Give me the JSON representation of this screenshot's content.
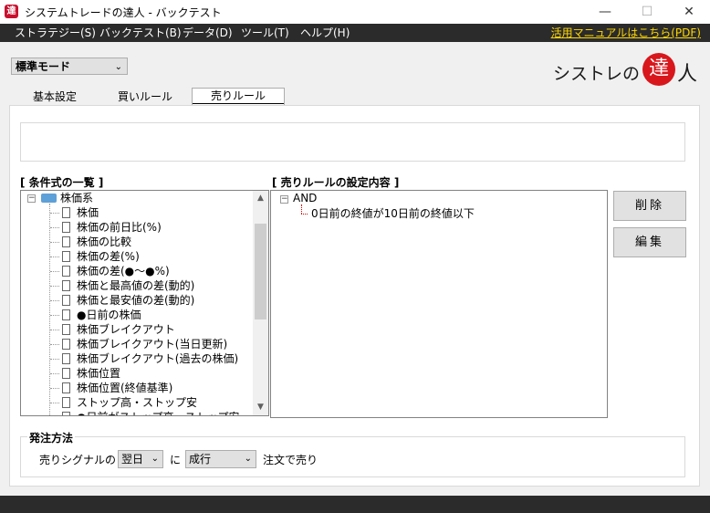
{
  "window": {
    "title": "システムトレードの達人 - バックテスト",
    "icon_glyph": "達",
    "minimize": "—",
    "maximize": "☐",
    "close": "✕"
  },
  "menu": {
    "items": [
      "ストラテジー(S)",
      "バックテスト(B)",
      "データ(D)",
      "ツール(T)",
      "ヘルプ(H)"
    ],
    "manual_link": "活用マニュアルはこちら(PDF)"
  },
  "mode": {
    "selected": "標準モード"
  },
  "logo": {
    "prefix": "シストレの",
    "seal": "達",
    "suffix": "人"
  },
  "tabs": [
    {
      "label": "基本設定",
      "active": false
    },
    {
      "label": "買いルール",
      "active": false
    },
    {
      "label": "売りルール",
      "active": true
    }
  ],
  "conditions": {
    "header": "[ 条件式の一覧 ]",
    "root": "株価系",
    "items": [
      "株価",
      "株価の前日比(%)",
      "株価の比較",
      "株価の差(%)",
      "株価の差(●〜●%)",
      "株価と最高値の差(動的)",
      "株価と最安値の差(動的)",
      "●日前の株価",
      "株価ブレイクアウト",
      "株価ブレイクアウト(当日更新)",
      "株価ブレイクアウト(過去の株価)",
      "株価位置",
      "株価位置(終値基準)",
      "ストップ高・ストップ安",
      "●日前がストップ高・ストップ安"
    ]
  },
  "rules": {
    "header": "[ 売りルールの設定内容 ]",
    "root": "AND",
    "items": [
      "0日前の終値が10日前の終値以下"
    ]
  },
  "buttons": {
    "delete": "削除",
    "edit": "編集"
  },
  "order": {
    "title": "発注方法",
    "prefix": "売りシグナルの",
    "timing": "翌日",
    "connector": "に",
    "type": "成行",
    "suffix": "注文で売り"
  }
}
